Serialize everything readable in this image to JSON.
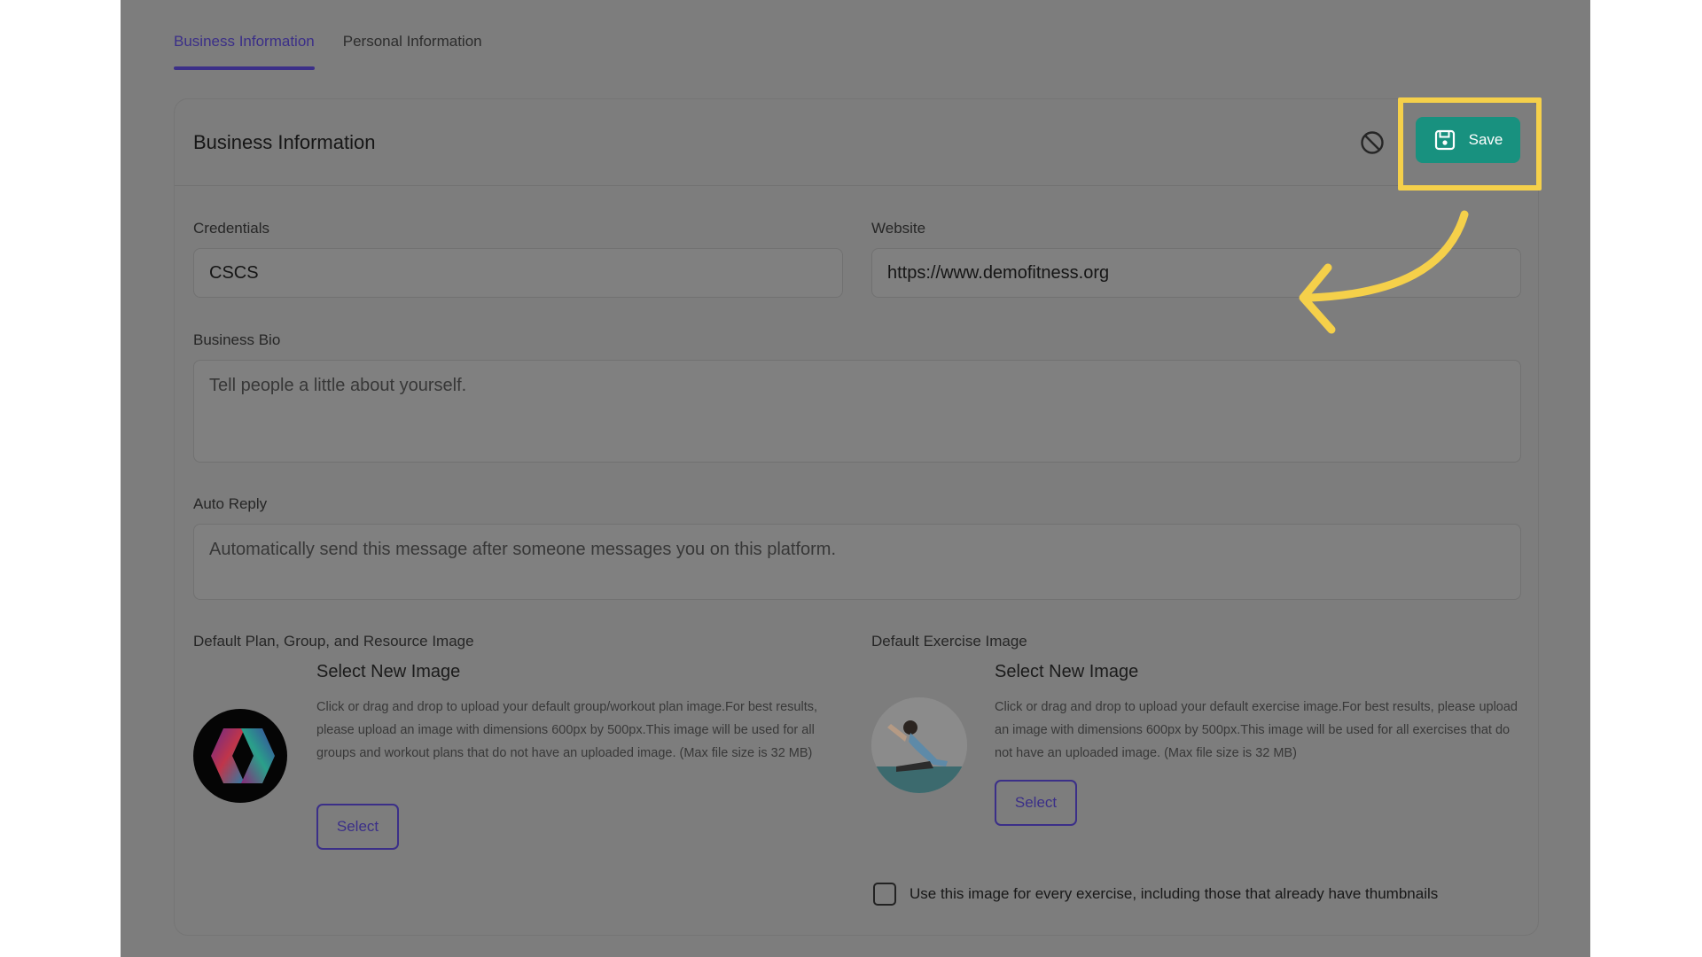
{
  "tabs": [
    {
      "label": "Business Information",
      "active": true
    },
    {
      "label": "Personal Information",
      "active": false
    }
  ],
  "card": {
    "title": "Business Information",
    "save_label": "Save"
  },
  "fields": {
    "credentials": {
      "label": "Credentials",
      "value": "CSCS"
    },
    "website": {
      "label": "Website",
      "value": "https://www.demofitness.org"
    },
    "bio": {
      "label": "Business Bio",
      "placeholder": "Tell people a little about yourself."
    },
    "auto_reply": {
      "label": "Auto Reply",
      "placeholder": "Automatically send this message after someone messages you on this platform."
    }
  },
  "plan_image": {
    "label": "Default Plan, Group, and Resource Image",
    "title": "Select New Image",
    "description": "Click or drag and drop to upload your default group/workout plan image.For best results, please upload an image with dimensions 600px by 500px.This image will be used for all groups and workout plans that do not have an uploaded image. (Max file size is 32 MB)",
    "select_label": "Select"
  },
  "exercise_image": {
    "label": "Default Exercise Image",
    "title": "Select New Image",
    "description": "Click or drag and drop to upload your default exercise image.For best results, please upload an image with dimensions 600px by 500px.This image will be used for all exercises that do not have an uploaded image. (Max file size is 32 MB)",
    "select_label": "Select",
    "checkbox_label": "Use this image for every exercise, including those that already have thumbnails",
    "checkbox_checked": false
  },
  "colors": {
    "accent": "#3b2f88",
    "save": "#18917f",
    "highlight": "#f5d04a",
    "overlay": "#7d7d7d"
  },
  "icons": [
    "save-icon",
    "ban-icon",
    "annotation-arrow"
  ]
}
